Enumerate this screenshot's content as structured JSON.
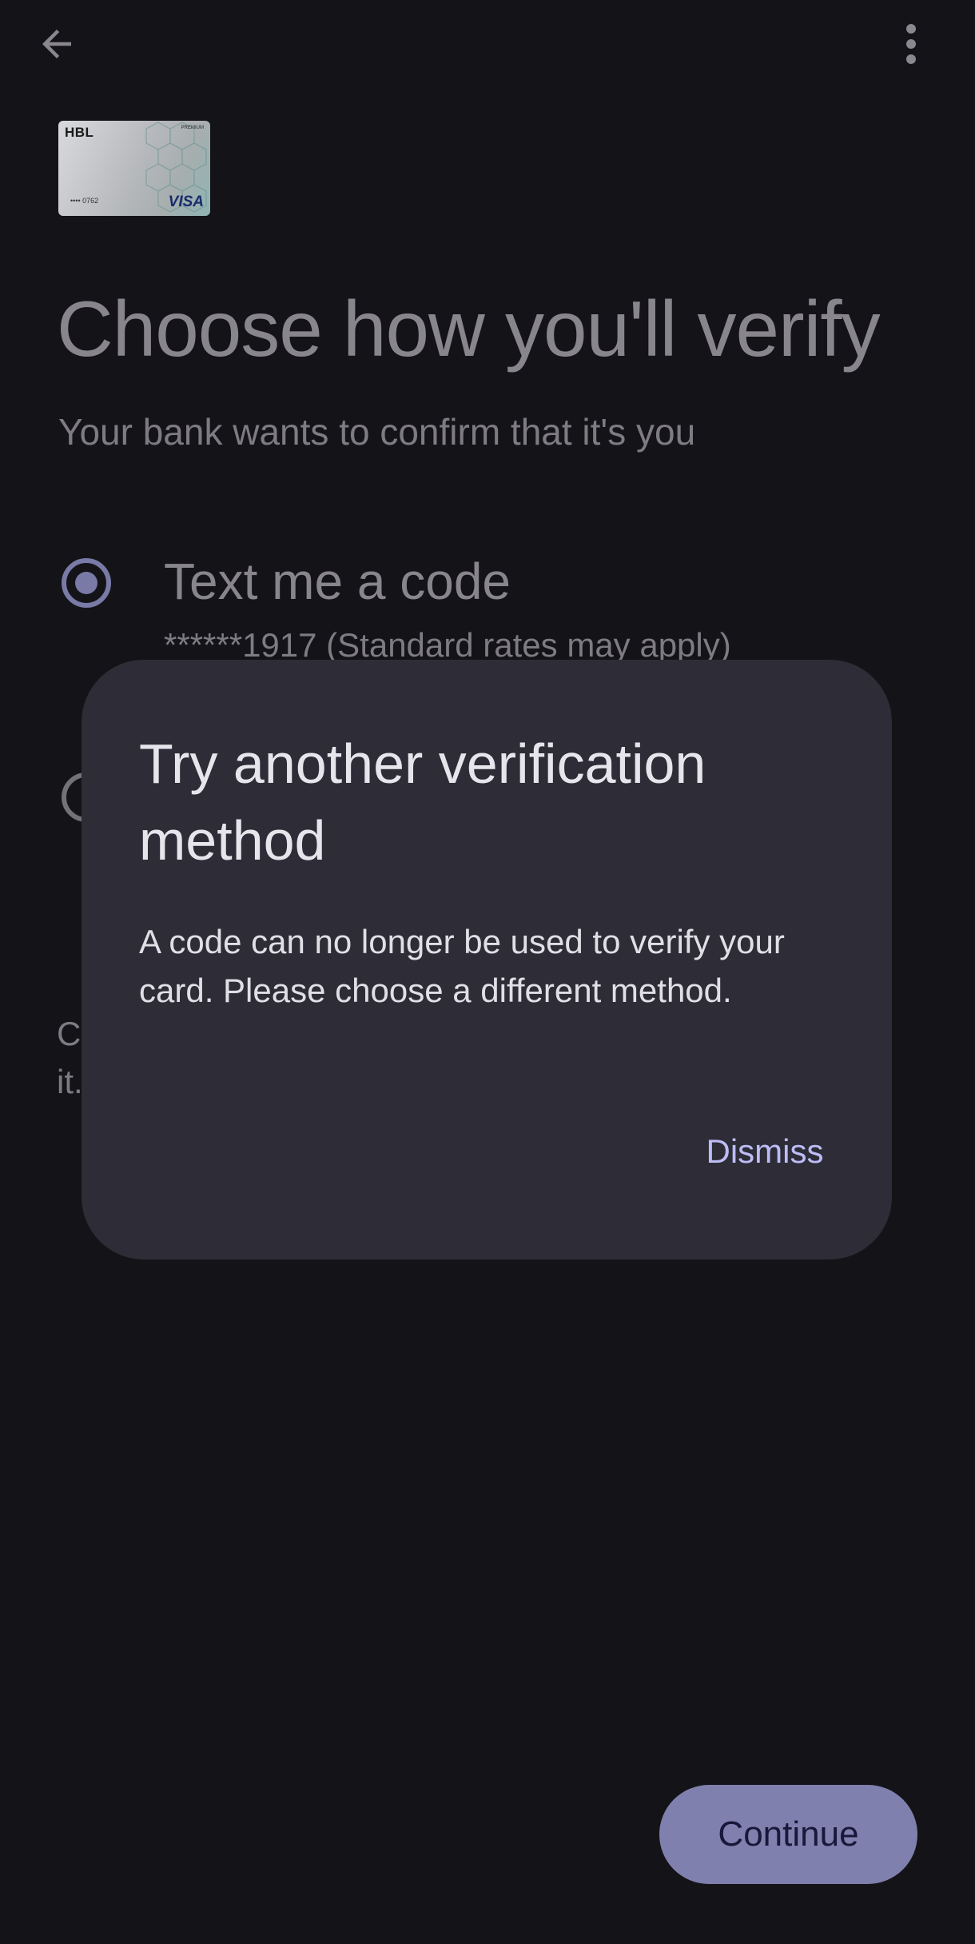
{
  "app_bar": {
    "back_icon": "arrow-back-icon",
    "more_icon": "more-vert-icon"
  },
  "card": {
    "bank": "HBL",
    "network": "VISA",
    "number_masked": "•••• 0762",
    "mini_label": "PREMIUM"
  },
  "page": {
    "title": "Choose how you'll verify",
    "subtitle": "Your bank wants to confirm that it's you"
  },
  "options": [
    {
      "label": "Text me a code",
      "detail": "******1917 (Standard rates may apply)",
      "selected": true
    },
    {
      "label": "",
      "selected": false
    }
  ],
  "footnote_peek": {
    "line1": "C",
    "line2": "it."
  },
  "continue_label": "Continue",
  "dialog": {
    "title": "Try another verification method",
    "body": "A code can no longer be used to verify your card. Please choose a different method.",
    "dismiss_label": "Dismiss"
  },
  "colors": {
    "background": "#141318",
    "dialog_surface": "#2d2c37",
    "accent": "#bdbcf5",
    "primary_button": "#7f80ad"
  }
}
